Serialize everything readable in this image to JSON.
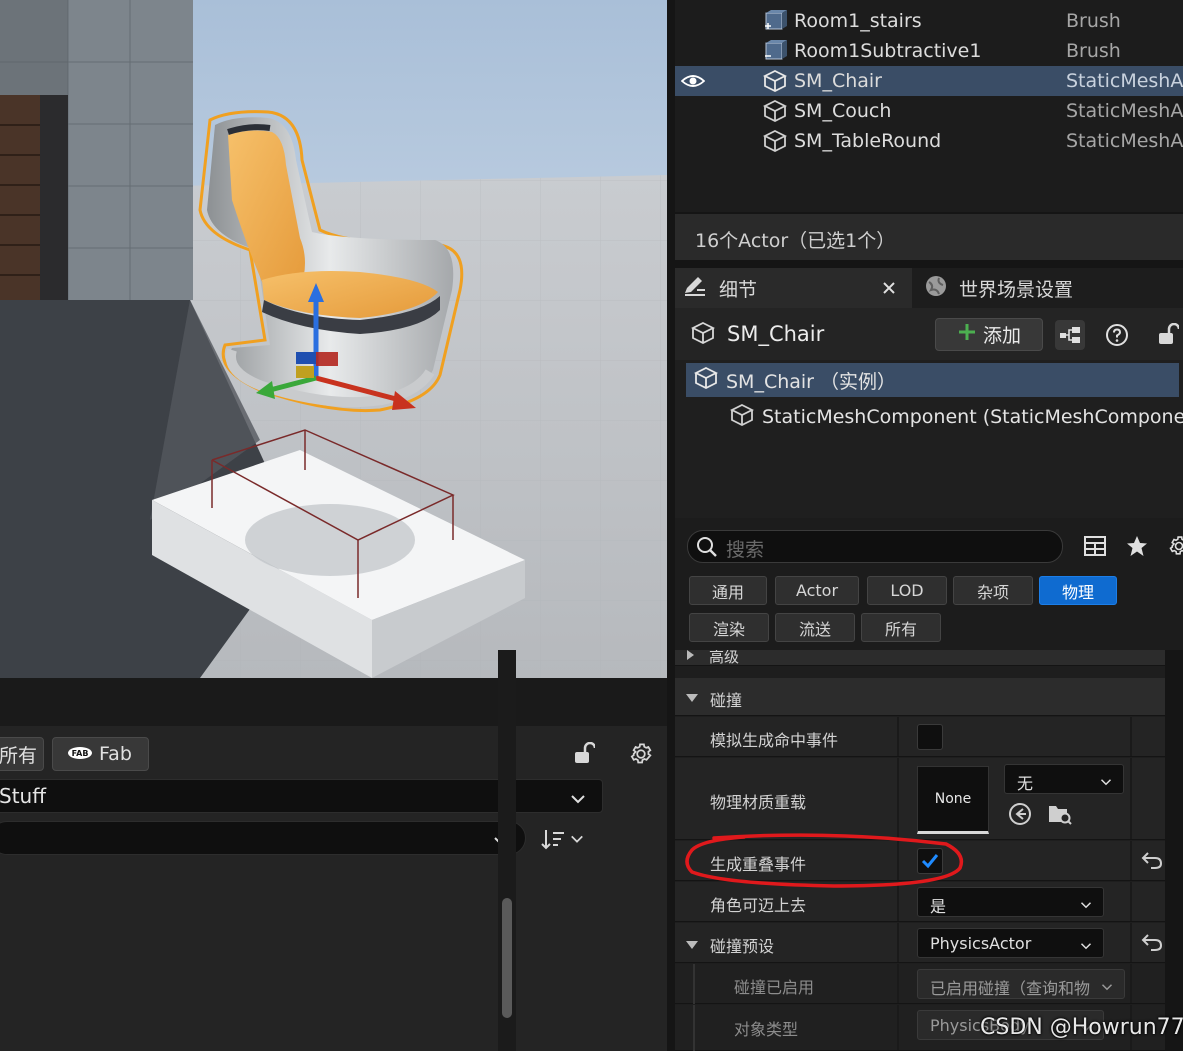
{
  "outliner": {
    "rows": [
      {
        "name": "Room1_stairs",
        "type": "Brush",
        "icon": "brush-icon"
      },
      {
        "name": "Room1Subtractive1",
        "type": "Brush",
        "icon": "brush-icon"
      },
      {
        "name": "SM_Chair",
        "type": "StaticMeshAc",
        "icon": "static-mesh-icon",
        "selected": true,
        "visible_eye": true
      },
      {
        "name": "SM_Couch",
        "type": "StaticMeshAc",
        "icon": "static-mesh-icon"
      },
      {
        "name": "SM_TableRound",
        "type": "StaticMeshAc",
        "icon": "static-mesh-icon"
      }
    ],
    "status": "16个Actor（已选1个）"
  },
  "tabs": {
    "details": "细节",
    "world_settings": "世界场景设置"
  },
  "details": {
    "actor_name": "SM_Chair",
    "add_label": "添加",
    "components": {
      "root": "SM_Chair （实例）",
      "child": "StaticMeshComponent (StaticMeshComponent"
    },
    "search_placeholder": "搜索",
    "filter_tabs": [
      "通用",
      "Actor",
      "LOD",
      "杂项",
      "物理",
      "渲染",
      "流送",
      "所有"
    ],
    "active_filter": "物理",
    "partial_row": "高级",
    "properties": {
      "collision_category": "碰撞",
      "simulation_hit_events": {
        "label": "模拟生成命中事件",
        "checked": false
      },
      "phys_material_override": {
        "label": "物理材质重载",
        "thumbnail": "None",
        "value": "无"
      },
      "generate_overlap_events": {
        "label": "生成重叠事件",
        "checked": true
      },
      "can_step_up": {
        "label": "角色可迈上去",
        "value": "是"
      },
      "collision_presets": {
        "label": "碰撞预设",
        "value": "PhysicsActor"
      },
      "collision_enabled": {
        "label": "碰撞已启用",
        "value": "已启用碰撞（查询和物"
      },
      "object_type": {
        "label": "对象类型",
        "value": "PhysicsBody"
      }
    }
  },
  "content_browser": {
    "all_label": "所有",
    "fab_label": "Fab",
    "path": "Stuff",
    "filter_value": ""
  },
  "colors": {
    "selection": "#3a4d66",
    "accent_blue": "#0f6bd0",
    "add_green": "#4caf50",
    "annotation_red": "#e0191c"
  },
  "watermark": "CSDN @Howrun777"
}
